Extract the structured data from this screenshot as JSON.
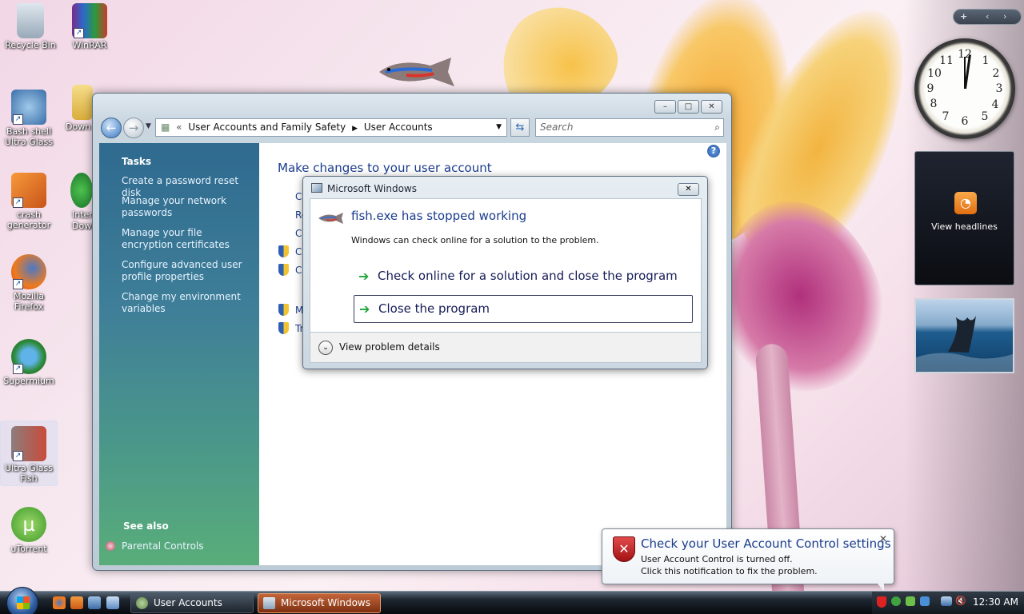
{
  "desktop": {
    "icons": [
      {
        "label": "Recycle Bin"
      },
      {
        "label": "WinRAR"
      },
      {
        "label": "Bash shell Ultra Glass"
      },
      {
        "label": "Down"
      },
      {
        "label": "crash generator"
      },
      {
        "label": "Inter Down"
      },
      {
        "label": "Mozilla Firefox"
      },
      {
        "label": "Supermium"
      },
      {
        "label": "Ultra Glass Fish"
      },
      {
        "label": "uTorrent"
      }
    ]
  },
  "explorer": {
    "breadcrumb": {
      "root": "User Accounts and Family Safety",
      "current": "User Accounts"
    },
    "search_placeholder": "Search",
    "main_heading": "Make changes to your user account",
    "partial_links": [
      "Cl",
      "Re",
      "Cl",
      "Cl",
      "Cl",
      "M",
      "Tr"
    ],
    "tasks_heading": "Tasks",
    "tasks": [
      "Create a password reset disk",
      "Manage your network passwords",
      "Manage your file encryption certificates",
      "Configure advanced user profile properties",
      "Change my environment variables"
    ],
    "see_also_heading": "See also",
    "see_also": [
      "Parental Controls"
    ]
  },
  "dialog": {
    "title": "Microsoft Windows",
    "heading": "fish.exe has stopped working",
    "message": "Windows can check online for a solution to the problem.",
    "option_online": "Check online for a solution and close the program",
    "option_close": "Close the program",
    "details": "View problem details"
  },
  "gadgets": {
    "feeds_label": "View headlines",
    "clock_numbers": [
      "12",
      "1",
      "2",
      "3",
      "4",
      "5",
      "6",
      "7",
      "8",
      "9",
      "10",
      "11"
    ]
  },
  "notification": {
    "title": "Check your User Account Control settings",
    "line1": "User Account Control is turned off.",
    "line2": "Click this notification to fix the problem."
  },
  "taskbar": {
    "buttons": [
      "User Accounts",
      "Microsoft Windows"
    ],
    "time": "12:30 AM"
  },
  "colors": {
    "accent_link": "#1a3c8c",
    "task_pane": "#2f6a8f",
    "active_taskbar": "#c4653a"
  }
}
